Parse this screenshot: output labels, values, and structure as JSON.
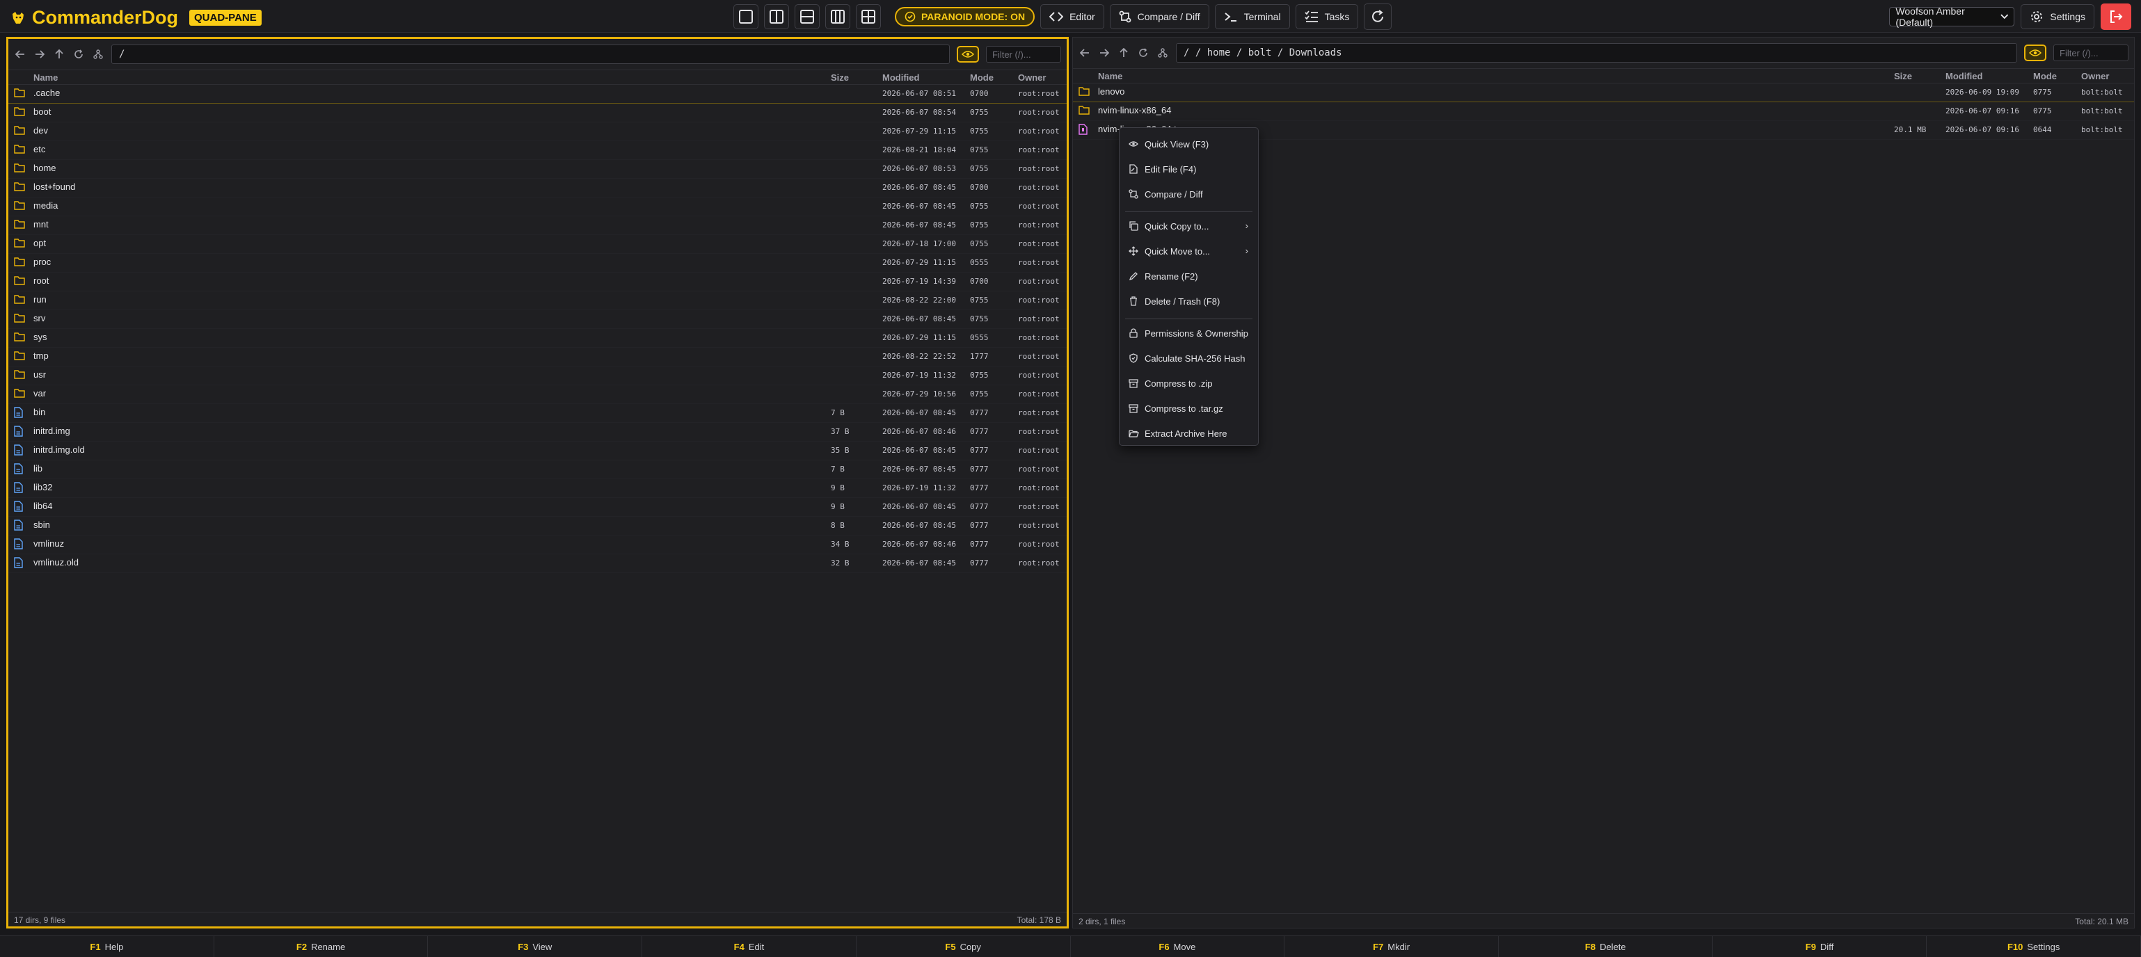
{
  "app": {
    "title": "CommanderDog",
    "badge": "QUAD-PANE",
    "paranoid_label": "PARANOID MODE: ON",
    "theme_selected": "Woofson Amber (Default)",
    "accent": "#eab308",
    "danger": "#ef4444"
  },
  "toolbar": {
    "editor": "Editor",
    "compare": "Compare / Diff",
    "terminal": "Terminal",
    "tasks": "Tasks",
    "settings": "Settings"
  },
  "columns": {
    "name": "Name",
    "size": "Size",
    "modified": "Modified",
    "mode": "Mode",
    "owner": "Owner"
  },
  "left_pane": {
    "path": "/",
    "filter_placeholder": "Filter (/)...",
    "status": "17 dirs, 9 files",
    "total": "Total: 178 B",
    "rows": [
      {
        "name": ".cache",
        "type": "dir",
        "size": "",
        "modified": "2026-06-07 08:51",
        "mode": "0700",
        "owner": "root:root"
      },
      {
        "name": "boot",
        "type": "dir",
        "size": "",
        "modified": "2026-06-07 08:54",
        "mode": "0755",
        "owner": "root:root"
      },
      {
        "name": "dev",
        "type": "dir",
        "size": "",
        "modified": "2026-07-29 11:15",
        "mode": "0755",
        "owner": "root:root"
      },
      {
        "name": "etc",
        "type": "dir",
        "size": "",
        "modified": "2026-08-21 18:04",
        "mode": "0755",
        "owner": "root:root"
      },
      {
        "name": "home",
        "type": "dir",
        "size": "",
        "modified": "2026-06-07 08:53",
        "mode": "0755",
        "owner": "root:root"
      },
      {
        "name": "lost+found",
        "type": "dir",
        "size": "",
        "modified": "2026-06-07 08:45",
        "mode": "0700",
        "owner": "root:root"
      },
      {
        "name": "media",
        "type": "dir",
        "size": "",
        "modified": "2026-06-07 08:45",
        "mode": "0755",
        "owner": "root:root"
      },
      {
        "name": "mnt",
        "type": "dir",
        "size": "",
        "modified": "2026-06-07 08:45",
        "mode": "0755",
        "owner": "root:root"
      },
      {
        "name": "opt",
        "type": "dir",
        "size": "",
        "modified": "2026-07-18 17:00",
        "mode": "0755",
        "owner": "root:root"
      },
      {
        "name": "proc",
        "type": "dir",
        "size": "",
        "modified": "2026-07-29 11:15",
        "mode": "0555",
        "owner": "root:root"
      },
      {
        "name": "root",
        "type": "dir",
        "size": "",
        "modified": "2026-07-19 14:39",
        "mode": "0700",
        "owner": "root:root"
      },
      {
        "name": "run",
        "type": "dir",
        "size": "",
        "modified": "2026-08-22 22:00",
        "mode": "0755",
        "owner": "root:root"
      },
      {
        "name": "srv",
        "type": "dir",
        "size": "",
        "modified": "2026-06-07 08:45",
        "mode": "0755",
        "owner": "root:root"
      },
      {
        "name": "sys",
        "type": "dir",
        "size": "",
        "modified": "2026-07-29 11:15",
        "mode": "0555",
        "owner": "root:root"
      },
      {
        "name": "tmp",
        "type": "dir",
        "size": "",
        "modified": "2026-08-22 22:52",
        "mode": "1777",
        "owner": "root:root"
      },
      {
        "name": "usr",
        "type": "dir",
        "size": "",
        "modified": "2026-07-19 11:32",
        "mode": "0755",
        "owner": "root:root"
      },
      {
        "name": "var",
        "type": "dir",
        "size": "",
        "modified": "2026-07-29 10:56",
        "mode": "0755",
        "owner": "root:root"
      },
      {
        "name": "bin",
        "type": "link",
        "size": "7 B",
        "modified": "2026-06-07 08:45",
        "mode": "0777",
        "owner": "root:root"
      },
      {
        "name": "initrd.img",
        "type": "link",
        "size": "37 B",
        "modified": "2026-06-07 08:46",
        "mode": "0777",
        "owner": "root:root"
      },
      {
        "name": "initrd.img.old",
        "type": "link",
        "size": "35 B",
        "modified": "2026-06-07 08:45",
        "mode": "0777",
        "owner": "root:root"
      },
      {
        "name": "lib",
        "type": "link",
        "size": "7 B",
        "modified": "2026-06-07 08:45",
        "mode": "0777",
        "owner": "root:root"
      },
      {
        "name": "lib32",
        "type": "link",
        "size": "9 B",
        "modified": "2026-07-19 11:32",
        "mode": "0777",
        "owner": "root:root"
      },
      {
        "name": "lib64",
        "type": "link",
        "size": "9 B",
        "modified": "2026-06-07 08:45",
        "mode": "0777",
        "owner": "root:root"
      },
      {
        "name": "sbin",
        "type": "link",
        "size": "8 B",
        "modified": "2026-06-07 08:45",
        "mode": "0777",
        "owner": "root:root"
      },
      {
        "name": "vmlinuz",
        "type": "link",
        "size": "34 B",
        "modified": "2026-06-07 08:46",
        "mode": "0777",
        "owner": "root:root"
      },
      {
        "name": "vmlinuz.old",
        "type": "link",
        "size": "32 B",
        "modified": "2026-06-07 08:45",
        "mode": "0777",
        "owner": "root:root"
      }
    ]
  },
  "right_pane": {
    "path": "/ / home / bolt / Downloads",
    "filter_placeholder": "Filter (/)...",
    "status": "2 dirs, 1 files",
    "total": "Total: 20.1 MB",
    "rows": [
      {
        "name": "lenovo",
        "type": "dir",
        "size": "",
        "modified": "2026-06-09 19:09",
        "mode": "0775",
        "owner": "bolt:bolt"
      },
      {
        "name": "nvim-linux-x86_64",
        "type": "dir",
        "size": "",
        "modified": "2026-06-07 09:16",
        "mode": "0775",
        "owner": "bolt:bolt"
      },
      {
        "name": "nvim-linux-x86_64.tar.gz",
        "type": "archive",
        "size": "20.1 MB",
        "modified": "2026-06-07 09:16",
        "mode": "0644",
        "owner": "bolt:bolt"
      }
    ]
  },
  "context_menu": [
    {
      "label": "Quick View (F3)",
      "icon": "eye-icon"
    },
    {
      "label": "Edit File (F4)",
      "icon": "file-edit-icon"
    },
    {
      "label": "Compare / Diff",
      "icon": "compare-icon"
    },
    {
      "label": "Quick Copy to...",
      "icon": "copy-icon",
      "submenu": true
    },
    {
      "label": "Quick Move to...",
      "icon": "move-icon",
      "submenu": true
    },
    {
      "label": "Rename (F2)",
      "icon": "pencil-icon"
    },
    {
      "label": "Delete / Trash (F8)",
      "icon": "trash-icon"
    },
    {
      "label": "Permissions & Ownership",
      "icon": "lock-icon"
    },
    {
      "label": "Calculate SHA-256 Hash",
      "icon": "shield-check-icon"
    },
    {
      "label": "Compress to .zip",
      "icon": "archive-icon"
    },
    {
      "label": "Compress to .tar.gz",
      "icon": "archive-icon"
    },
    {
      "label": "Extract Archive Here",
      "icon": "folder-open-icon"
    }
  ],
  "fkeys": [
    {
      "key": "F1",
      "label": "Help"
    },
    {
      "key": "F2",
      "label": "Rename"
    },
    {
      "key": "F3",
      "label": "View"
    },
    {
      "key": "F4",
      "label": "Edit"
    },
    {
      "key": "F5",
      "label": "Copy"
    },
    {
      "key": "F6",
      "label": "Move"
    },
    {
      "key": "F7",
      "label": "Mkdir"
    },
    {
      "key": "F8",
      "label": "Delete"
    },
    {
      "key": "F9",
      "label": "Diff"
    },
    {
      "key": "F10",
      "label": "Settings"
    }
  ]
}
